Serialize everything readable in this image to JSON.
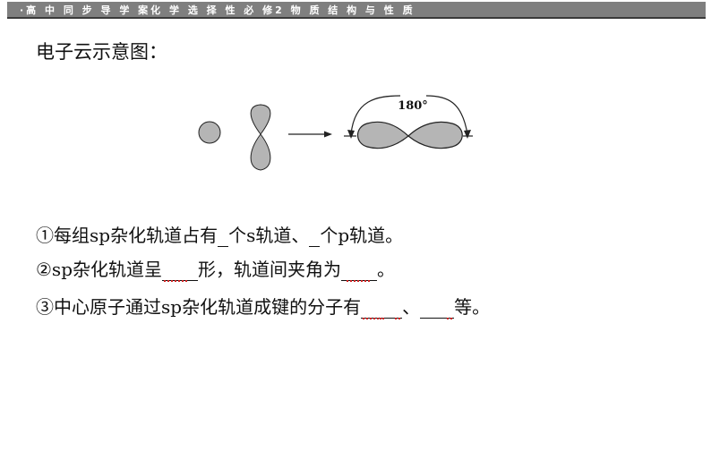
{
  "header": {
    "text": "·高 中 同 步 导 学 案化  学 选 择 性 必 修2 物 质 结 构 与 性 质"
  },
  "title": "电子云示意图：",
  "diagram": {
    "angle_label": "180°"
  },
  "lines": {
    "line1": {
      "p1": "①每组sp杂化轨道占有",
      "p2": "个s轨道、",
      "p3": "个p轨道。"
    },
    "line2": {
      "p1": "②sp杂化轨道呈",
      "p2": "形，轨道间夹角为",
      "p3": "。"
    },
    "line3": {
      "p1": "③中心原子通过sp杂化轨道成键的分子有",
      "p2": "、",
      "p3": "等。"
    }
  },
  "colors": {
    "header_bg": "#7f7f7f",
    "orbital_fill": "#b5b5b5",
    "answer_mark": "#d02020"
  }
}
